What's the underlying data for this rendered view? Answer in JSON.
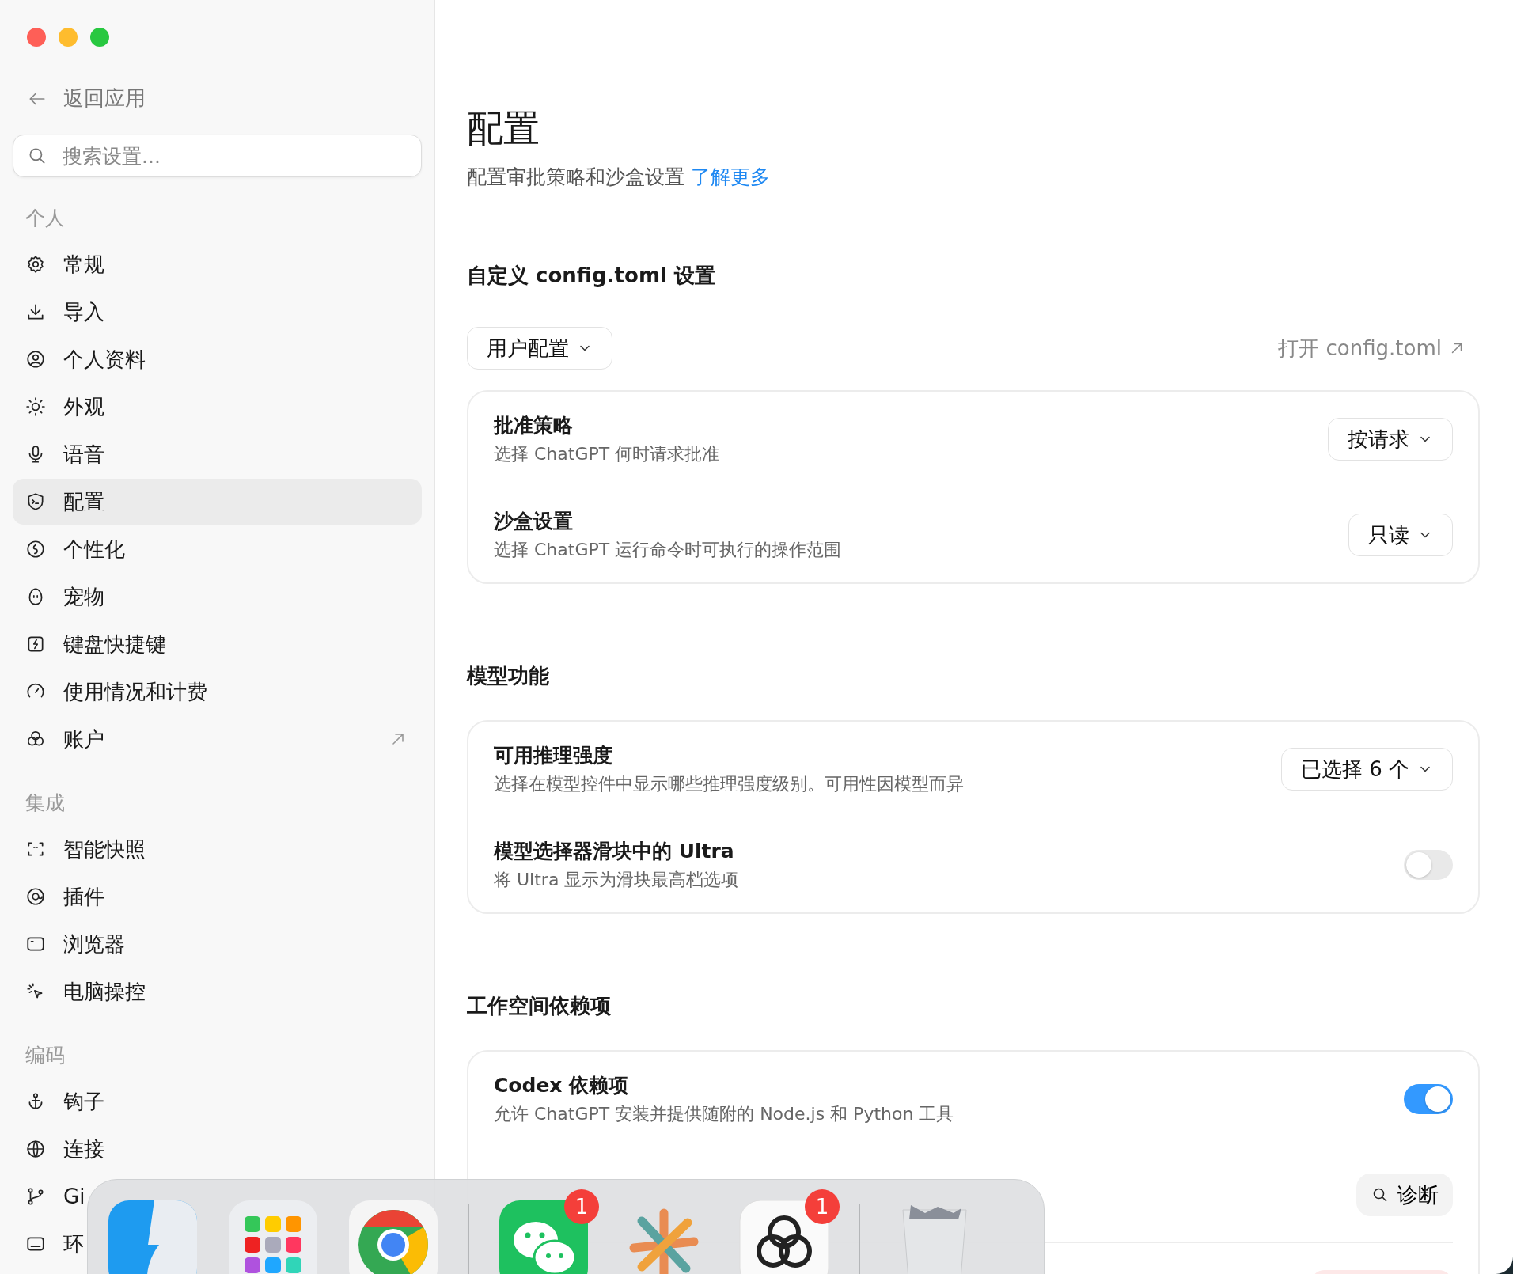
{
  "sidebar": {
    "back": "返回应用",
    "search": {
      "placeholder": "搜索设置..."
    },
    "groups": [
      {
        "heading": "个人",
        "items": [
          {
            "label": "常规",
            "selected": false,
            "external": false
          },
          {
            "label": "导入",
            "selected": false,
            "external": false
          },
          {
            "label": "个人资料",
            "selected": false,
            "external": false
          },
          {
            "label": "外观",
            "selected": false,
            "external": false
          },
          {
            "label": "语音",
            "selected": false,
            "external": false
          },
          {
            "label": "配置",
            "selected": true,
            "external": false
          },
          {
            "label": "个性化",
            "selected": false,
            "external": false
          },
          {
            "label": "宠物",
            "selected": false,
            "external": false
          },
          {
            "label": "键盘快捷键",
            "selected": false,
            "external": false
          },
          {
            "label": "使用情况和计费",
            "selected": false,
            "external": false
          },
          {
            "label": "账户",
            "selected": false,
            "external": true
          }
        ]
      },
      {
        "heading": "集成",
        "items": [
          {
            "label": "智能快照",
            "selected": false,
            "external": false
          },
          {
            "label": "插件",
            "selected": false,
            "external": false
          },
          {
            "label": "浏览器",
            "selected": false,
            "external": false
          },
          {
            "label": "电脑操控",
            "selected": false,
            "external": false
          }
        ]
      },
      {
        "heading": "编码",
        "items": [
          {
            "label": "钩子",
            "selected": false,
            "external": false
          },
          {
            "label": "连接",
            "selected": false,
            "external": false
          },
          {
            "label": "Gi",
            "selected": false,
            "external": false
          },
          {
            "label": "环",
            "selected": false,
            "external": false
          }
        ]
      }
    ]
  },
  "main": {
    "title": "配置",
    "subtitle": "配置审批策略和沙盒设置",
    "learn_more": "了解更多",
    "sections": [
      {
        "heading": "自定义 config.toml 设置",
        "profile": "用户配置",
        "open_link": "打开 config.toml",
        "rows": [
          {
            "kind": "select",
            "title": "批准策略",
            "description": "选择 ChatGPT 何时请求批准",
            "value": "按请求"
          },
          {
            "kind": "select",
            "title": "沙盒设置",
            "description": "选择 ChatGPT 运行命令时可执行的操作范围",
            "value": "只读"
          }
        ]
      },
      {
        "heading": "模型功能",
        "rows": [
          {
            "kind": "select",
            "title": "可用推理强度",
            "description": "选择在模型控件中显示哪些推理强度级别。可用性因模型而异",
            "value": "已选择 6 个"
          },
          {
            "kind": "toggle",
            "title": "模型选择器滑块中的 Ultra",
            "description": "将 Ultra 显示为滑块最高档选项",
            "on": false
          }
        ]
      },
      {
        "heading": "工作空间依赖项",
        "rows": [
          {
            "kind": "toggle",
            "title": "Codex 依赖项",
            "description": "允许 ChatGPT 安装并提供随附的 Node.js 和 Python 工具",
            "on": true
          },
          {
            "kind": "button",
            "button": "诊断"
          },
          {
            "kind": "danger"
          }
        ]
      }
    ]
  },
  "dock": [
    {
      "kind": "app"
    },
    {
      "kind": "app"
    },
    {
      "kind": "app"
    },
    {
      "kind": "separator"
    },
    {
      "kind": "app",
      "badge": "1"
    },
    {
      "kind": "app"
    },
    {
      "kind": "app",
      "badge": "1"
    },
    {
      "kind": "separator"
    },
    {
      "kind": "app"
    }
  ]
}
